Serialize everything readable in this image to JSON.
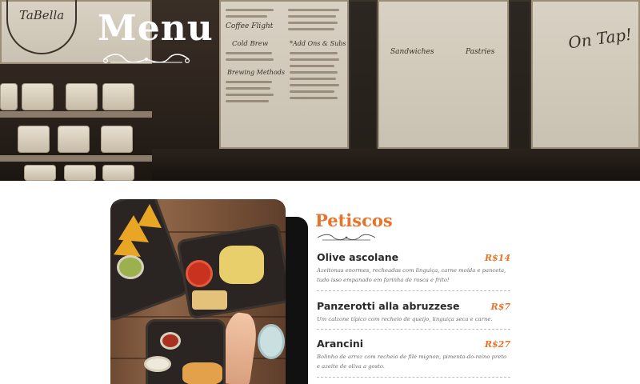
{
  "hero": {
    "title": "Menu",
    "logo_text": "TaBella",
    "scene_labels": {
      "sandwiches": "Sandwiches",
      "pastries": "Pastries",
      "on_tap": "On Tap!"
    },
    "board_text": {
      "coffee_flight": "Coffee Flight",
      "cold_brew": "Cold Brew",
      "brewing_methods": "Brewing Methods",
      "add_ons": "*Add Ons & Subs"
    }
  },
  "section": {
    "title": "Petiscos",
    "items": [
      {
        "name": "Olive ascolane",
        "price": "R$14",
        "description": "Azeitonas enormes, recheadas com linguiça, carne moída e panceta, tudo isso empanado em farinha de rosca e frito!"
      },
      {
        "name": "Panzerotti alla abruzzese",
        "price": "R$7",
        "description": "Um calzone típico com recheio de queijo, linguiça seca e carne."
      },
      {
        "name": "Arancini",
        "price": "R$27",
        "description": "Bolinho de arroz com recheio de filé mignon, pimenta-do-reino preto e azeite de oliva a gosto."
      }
    ]
  },
  "colors": {
    "accent": "#e8742b",
    "hero_dark": "#2b221c",
    "text": "#2a2a2a"
  }
}
